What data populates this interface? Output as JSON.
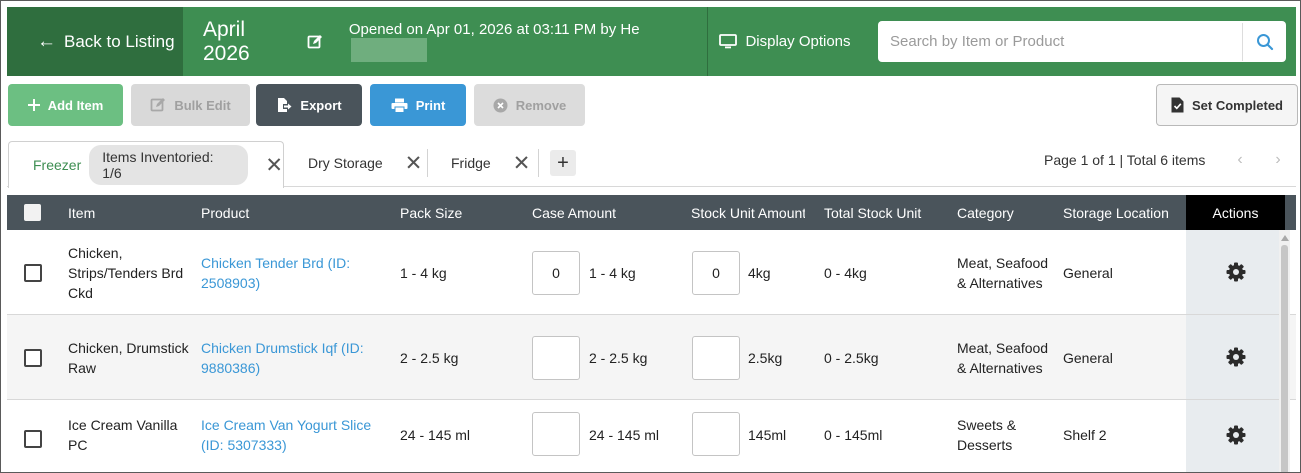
{
  "header": {
    "back_label": "Back to Listing",
    "month_title": "April 2026",
    "opened_text": "Opened on Apr 01, 2026 at 03:11 PM by He",
    "display_options_label": "Display Options",
    "search_placeholder": "Search by Item or Product"
  },
  "toolbar": {
    "add_item": "Add Item",
    "bulk_edit": "Bulk Edit",
    "export": "Export",
    "print": "Print",
    "remove": "Remove",
    "set_completed": "Set Completed"
  },
  "tabs": {
    "active": {
      "name": "Freezer",
      "badge": "Items Inventoried: 1/6"
    },
    "others": [
      {
        "name": "Dry Storage"
      },
      {
        "name": "Fridge"
      }
    ],
    "add_symbol": "+",
    "close_symbol": "✕",
    "page_info": "Page 1 of 1 | Total 6 items",
    "prev_symbol": "‹",
    "next_symbol": "›"
  },
  "table": {
    "columns": [
      "Item",
      "Product",
      "Pack Size",
      "Case Amount",
      "Stock Unit Amount",
      "Total Stock Unit",
      "Category",
      "Storage Location",
      "Actions"
    ],
    "rows": [
      {
        "item": "Chicken, Strips/Tenders Brd Ckd",
        "product": "Chicken Tender Brd (ID: 2508903)",
        "pack_size": "1 - 4 kg",
        "case_amount": "0",
        "case_unit": "1 - 4 kg",
        "stock_amount": "0",
        "stock_unit": "4kg",
        "total_stock": "0 - 4kg",
        "category": "Meat, Seafood & Alternatives",
        "storage": "General"
      },
      {
        "item": "Chicken, Drumstick Raw",
        "product": "Chicken Drumstick Iqf (ID: 9880386)",
        "pack_size": "2 - 2.5 kg",
        "case_amount": "",
        "case_unit": "2 - 2.5 kg",
        "stock_amount": "",
        "stock_unit": "2.5kg",
        "total_stock": "0 - 2.5kg",
        "category": "Meat, Seafood & Alternatives",
        "storage": "General"
      },
      {
        "item": "Ice Cream Vanilla PC",
        "product": "Ice Cream Van Yogurt Slice (ID: 5307333)",
        "pack_size": "24 - 145 ml",
        "case_amount": "",
        "case_unit": "24 - 145 ml",
        "stock_amount": "",
        "stock_unit": "145ml",
        "total_stock": "0 - 145ml",
        "category": "Sweets & Desserts",
        "storage": "Shelf 2"
      }
    ]
  },
  "colors": {
    "header_green": "#3e8e52",
    "back_dark_green": "#2f6e3e",
    "add_green": "#6cbf82",
    "export_slate": "#4a545b",
    "print_blue": "#3a97d6",
    "link_blue": "#3a97d6"
  },
  "icons": {
    "back": "arrow-left-icon",
    "edit": "edit-icon",
    "display": "monitor-icon",
    "search": "search-icon",
    "add": "plus-icon",
    "bulk_edit": "edit-icon",
    "export": "export-icon",
    "print": "printer-icon",
    "remove": "remove-icon",
    "set_completed": "document-check-icon",
    "actions": "gear-icon"
  }
}
